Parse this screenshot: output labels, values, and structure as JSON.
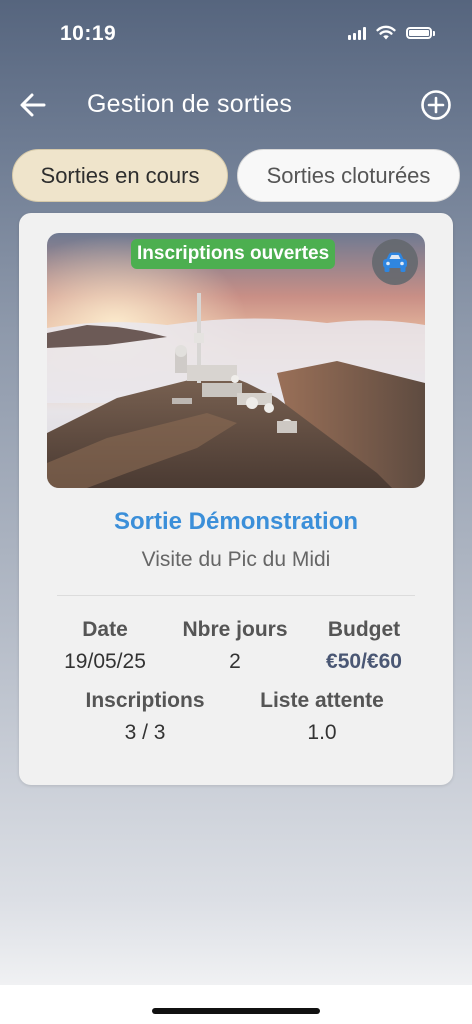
{
  "status_bar": {
    "time": "10:19"
  },
  "app_bar": {
    "title": "Gestion de sorties"
  },
  "tabs": [
    {
      "label": "Sorties en cours",
      "active": true
    },
    {
      "label": "Sorties cloturées",
      "active": false
    }
  ],
  "card": {
    "badge": "Inscriptions ouvertes",
    "transport_icon": "car-icon",
    "title": "Sortie Démonstration",
    "subtitle": "Visite du Pic du Midi",
    "info": {
      "date_label": "Date",
      "date_value": "19/05/25",
      "days_label": "Nbre jours",
      "days_value": "2",
      "budget_label": "Budget",
      "budget_value": "€50/€60",
      "registrations_label": "Inscriptions",
      "registrations_value": "3 / 3",
      "waitlist_label": "Liste attente",
      "waitlist_value": "1.0"
    }
  },
  "colors": {
    "header": "#56657e",
    "accent_blue": "#3b8fd9",
    "badge_green": "#4caf50",
    "active_tab": "#efe4cb",
    "budget_text": "#4a5774"
  }
}
